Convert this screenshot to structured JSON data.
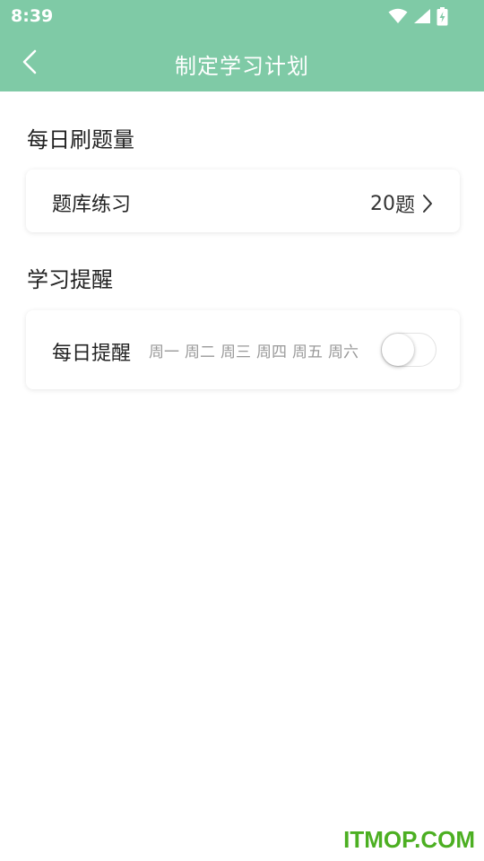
{
  "status_bar": {
    "time": "8:39"
  },
  "header": {
    "title": "制定学习计划"
  },
  "sections": {
    "daily_questions": {
      "title": "每日刷题量",
      "item_label": "题库练习",
      "count": "20",
      "unit": "题"
    },
    "reminder": {
      "title": "学习提醒",
      "item_label": "每日提醒",
      "weekdays": [
        "周一",
        "周二",
        "周三",
        "周四",
        "周五",
        "周六"
      ],
      "enabled": false
    }
  },
  "watermark": "ITMOP.COM",
  "colors": {
    "header_bg": "#7fcaa6",
    "watermark": "#4caf22"
  }
}
